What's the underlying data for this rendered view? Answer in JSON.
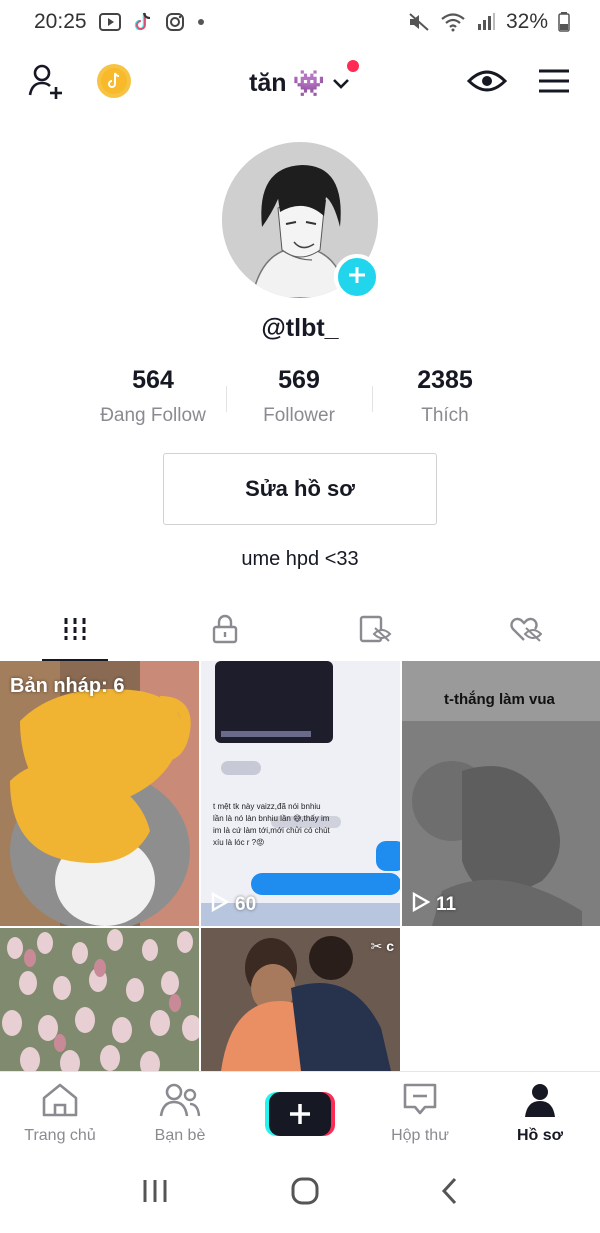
{
  "status_bar": {
    "time": "20:25",
    "battery": "32%"
  },
  "header": {
    "username": "tăn",
    "username_emoji": "👾"
  },
  "profile": {
    "handle": "@tlbt_",
    "stats": [
      {
        "value": "564",
        "label": "Đang Follow"
      },
      {
        "value": "569",
        "label": "Follower"
      },
      {
        "value": "2385",
        "label": "Thích"
      }
    ],
    "edit_button": "Sửa hồ sơ",
    "bio": "ume hpd <33"
  },
  "tabs": [
    "videos-grid-icon",
    "lock-icon",
    "hidden-icon",
    "heart-hidden-icon"
  ],
  "videos": [
    {
      "label": "Bản nháp: 6",
      "type": "drafts"
    },
    {
      "overlay_text": "t mệt tk này vaizz,đã nói bnhiu lần là nó làn bnhiu lần 😅,thấy im im là cứ làm tới,mới chửi có chút xíu là lóc r ?😡",
      "views": "60"
    },
    {
      "overlay_text": "t-thắng làm vua",
      "views": "11"
    },
    {
      "type": "tulips"
    },
    {
      "type": "photo",
      "watermark": "✂ c"
    }
  ],
  "bottom_nav": [
    {
      "label": "Trang chủ",
      "icon": "home-icon",
      "active": false
    },
    {
      "label": "Bạn bè",
      "icon": "friends-icon",
      "active": false
    },
    {
      "label": "",
      "icon": "create-icon",
      "active": false
    },
    {
      "label": "Hộp thư",
      "icon": "inbox-icon",
      "active": false
    },
    {
      "label": "Hồ sơ",
      "icon": "profile-icon",
      "active": true
    }
  ],
  "colors": {
    "accent_pink": "#fe2c55",
    "accent_cyan": "#20d5ec",
    "text_primary": "#161823",
    "text_secondary": "#8a8b91"
  }
}
